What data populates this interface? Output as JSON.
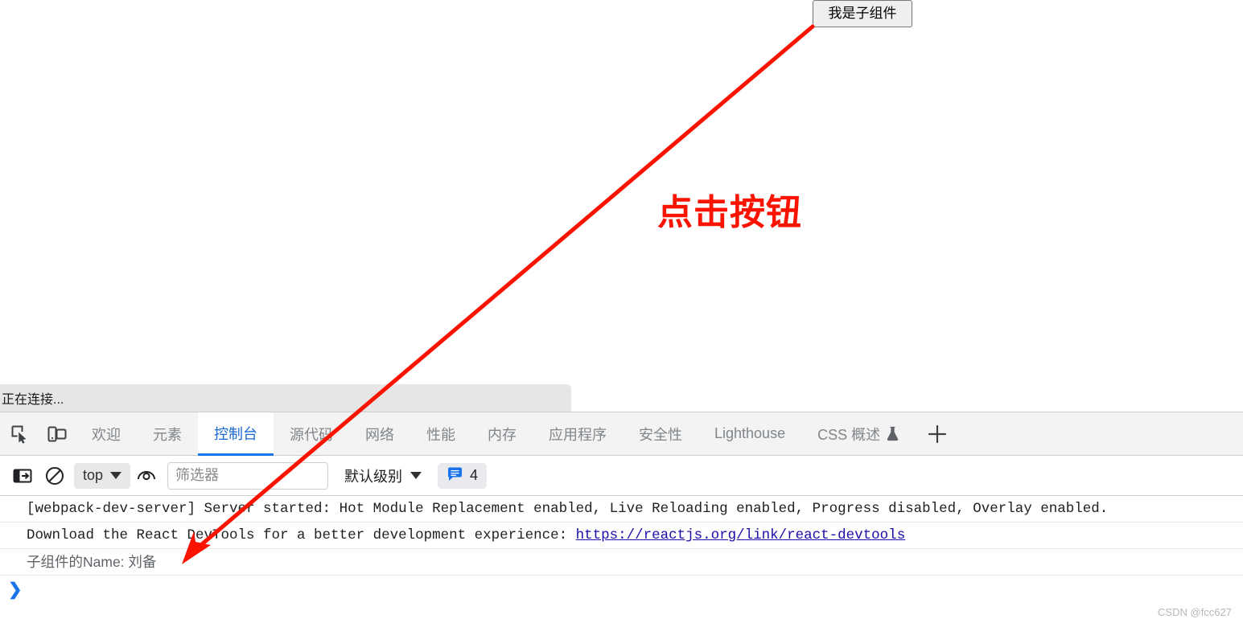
{
  "page": {
    "child_button_label": "我是子组件",
    "annotation_text": "点击按钮",
    "annotation_color": "#fa1400",
    "status_bar_text": "正在连接..."
  },
  "devtools": {
    "icons": {
      "inspect": "inspect-element-icon",
      "device": "device-toolbar-icon",
      "add_tab": "add-panel-icon"
    },
    "tabs": [
      {
        "label": "欢迎",
        "active": false
      },
      {
        "label": "元素",
        "active": false
      },
      {
        "label": "控制台",
        "active": true
      },
      {
        "label": "源代码",
        "active": false
      },
      {
        "label": "网络",
        "active": false
      },
      {
        "label": "性能",
        "active": false
      },
      {
        "label": "内存",
        "active": false
      },
      {
        "label": "应用程序",
        "active": false
      },
      {
        "label": "安全性",
        "active": false
      },
      {
        "label": "Lighthouse",
        "active": false
      },
      {
        "label": "CSS 概述",
        "active": false,
        "experimental": true
      }
    ],
    "add_tab_label": "+",
    "console_toolbar": {
      "sidebar_toggle_icon": "console-sidebar-icon",
      "clear_icon": "clear-console-icon",
      "context": "top",
      "eye_icon": "live-expression-icon",
      "filter_placeholder": "筛选器",
      "filter_value": "",
      "level": "默认级别",
      "issues_icon": "issues-message-icon",
      "issues_count": "4"
    },
    "messages": [
      {
        "text": "[webpack-dev-server] Server started: Hot Module Replacement enabled, Live Reloading enabled, Progress disabled, Overlay enabled.",
        "style": "normal"
      },
      {
        "text": "Download the React DevTools for a better development experience: ",
        "link": "https://reactjs.org/link/react-devtools",
        "style": "normal"
      },
      {
        "text": "子组件的Name: 刘备",
        "style": "dim"
      }
    ],
    "prompt_symbol": "❯"
  },
  "watermark": "CSDN @fcc627",
  "colors": {
    "accent": "#1a73e8",
    "annotation": "#fa1400",
    "link": "#1a0dab",
    "tab_inactive": "#80868b"
  }
}
